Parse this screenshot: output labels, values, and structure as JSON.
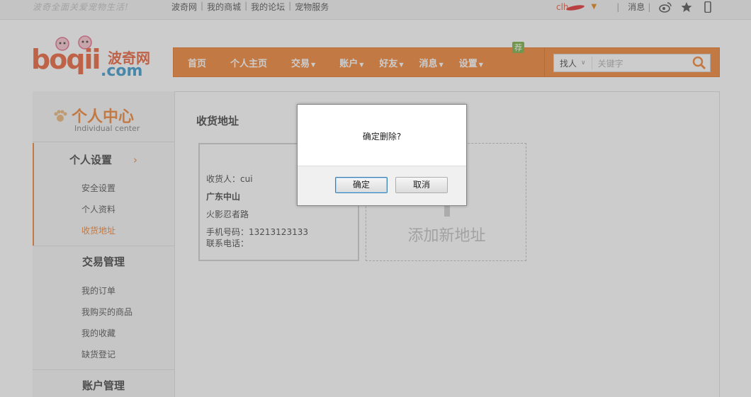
{
  "topbar": {
    "slogan": "波奇全面关爱宠物生活!",
    "links": [
      "波奇网",
      "我的商城",
      "我的论坛",
      "宠物服务"
    ],
    "username": "clh",
    "messages": "消息",
    "icons": [
      "weibo-icon",
      "star-icon",
      "mobile-icon"
    ]
  },
  "logo": {
    "text": "boqii",
    "cn": "波奇网",
    "domain": ".com"
  },
  "nav": {
    "items": [
      "首页",
      "个人主页",
      "交易",
      "账户",
      "好友",
      "消息",
      "设置"
    ],
    "badge": "荐",
    "search_scope": "找人",
    "search_placeholder": "关键字"
  },
  "sidebar": {
    "title": "个人中心",
    "subtitle": "Individual center",
    "sections": [
      {
        "label": "个人设置",
        "arrow": "›",
        "links": [
          "安全设置",
          "个人资料",
          "收货地址"
        ]
      },
      {
        "label": "交易管理",
        "links": [
          "我的订单",
          "我购买的商品",
          "我的收藏",
          "缺货登记"
        ]
      },
      {
        "label": "账户管理"
      }
    ]
  },
  "content": {
    "title": "收货地址",
    "address": {
      "receiver": "收货人：cui",
      "region": "广东中山",
      "street": "火影忍者路",
      "mobile": "手机号码：13213123133",
      "phone": "联系电话："
    },
    "add_label": "添加新地址"
  },
  "dialog": {
    "message": "确定删除?",
    "ok": "确定",
    "cancel": "取消"
  },
  "colors": {
    "accent": "#f07a22",
    "brand_blue": "#2a90c8",
    "badge_green": "#6fa834"
  }
}
